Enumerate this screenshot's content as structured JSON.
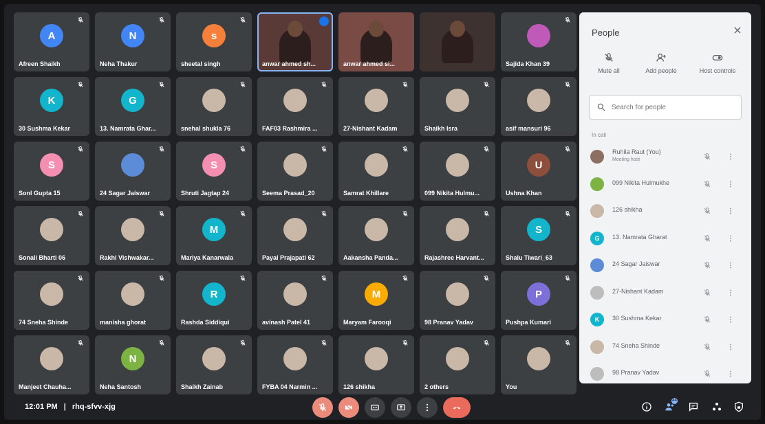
{
  "tiles": [
    {
      "name": "Afreen Shaikh",
      "initial": "A",
      "color": "#4285f4"
    },
    {
      "name": "Neha Thakur",
      "initial": "N",
      "color": "#4285f4"
    },
    {
      "name": "sheetal singh",
      "initial": "s",
      "color": "#f4803c"
    },
    {
      "name": "anwar ahmed sh...",
      "video": true
    },
    {
      "name": "anwar ahmed si...",
      "video": true
    },
    {
      "name": "",
      "video": true
    },
    {
      "name": "Sajida Khan 39",
      "initial": "",
      "color": "#c05ab8"
    },
    {
      "name": "30 Sushma Kekar",
      "initial": "K",
      "color": "#12b5cb"
    },
    {
      "name": "13. Namrata Ghar...",
      "initial": "G",
      "color": "#12b5cb"
    },
    {
      "name": "snehal shukla 76",
      "photo": true
    },
    {
      "name": "FAF03 Rashmira ...",
      "photo": true
    },
    {
      "name": "27-Nishant Kadam",
      "photo": true
    },
    {
      "name": "Shaikh Isra",
      "photo": true
    },
    {
      "name": "asif mansuri 96",
      "photo": true
    },
    {
      "name": "Sonl Gupta 15",
      "initial": "S",
      "color": "#f48fb1"
    },
    {
      "name": "24 Sagar Jaiswar",
      "initial": "",
      "color": "#5c8bd8"
    },
    {
      "name": "Shruti Jagtap 24",
      "initial": "S",
      "color": "#f48fb1"
    },
    {
      "name": "Seema Prasad_20",
      "photo": true
    },
    {
      "name": "Samrat Khillare",
      "photo": true
    },
    {
      "name": "099 Nikita Hulmu...",
      "photo": true
    },
    {
      "name": "Ushna Khan",
      "initial": "U",
      "color": "#8d4e3c"
    },
    {
      "name": "Sonali Bharti 06",
      "photo": true
    },
    {
      "name": "Rakhi Vishwakar...",
      "photo": true
    },
    {
      "name": "Mariya Kanarwala",
      "initial": "M",
      "color": "#12b5cb"
    },
    {
      "name": "Payal Prajapati 62",
      "photo": true
    },
    {
      "name": "Aakansha Panda...",
      "photo": true
    },
    {
      "name": "Rajashree Harvant...",
      "photo": true
    },
    {
      "name": "Shalu Tiwari_63",
      "initial": "S",
      "color": "#12b5cb"
    },
    {
      "name": "74 Sneha Shinde",
      "photo": true
    },
    {
      "name": "manisha ghorat",
      "photo": true
    },
    {
      "name": "Rashda Siddiqui",
      "initial": "R",
      "color": "#12b5cb"
    },
    {
      "name": "avinash Patel 41",
      "photo": true
    },
    {
      "name": "Maryam Farooqi",
      "initial": "M",
      "color": "#f9ab00"
    },
    {
      "name": "98 Pranav Yadav",
      "photo": true
    },
    {
      "name": "Pushpa Kumari",
      "initial": "P",
      "color": "#7c6fd8"
    },
    {
      "name": "Manjeet Chauha...",
      "photo": true
    },
    {
      "name": "Neha Santosh",
      "initial": "N",
      "color": "#7cb342"
    },
    {
      "name": "Shaikh Zainab",
      "photo": true
    },
    {
      "name": "FYBA 04 Narmin ...",
      "photo": true
    },
    {
      "name": "126 shikha",
      "photo": true
    },
    {
      "name": "2 others",
      "photo": true
    },
    {
      "name": "You",
      "photo": true
    }
  ],
  "bottom": {
    "time": "12:01 PM",
    "separator": "|",
    "code": "rhq-sfvv-xjg"
  },
  "panel": {
    "title": "People",
    "actions": [
      "Mute all",
      "Add people",
      "Host controls"
    ],
    "search_placeholder": "Search for people",
    "section": "In call",
    "participants": [
      {
        "name": "Ruhila Raut (You)",
        "role": "Meeting host",
        "color": "#8d6e63"
      },
      {
        "name": "099 Nikita Hulmukhe",
        "role": "",
        "color": "#7cb342"
      },
      {
        "name": "126 shikha",
        "role": "",
        "color": "#c9b7a8"
      },
      {
        "name": "13. Namrata Gharat",
        "role": "",
        "color": "#12b5cb",
        "initial": "G"
      },
      {
        "name": "24 Sagar Jaiswar",
        "role": "",
        "color": "#5c8bd8"
      },
      {
        "name": "27-Nishant Kadam",
        "role": "",
        "color": "#bdbdbd"
      },
      {
        "name": "30 Sushma Kekar",
        "role": "",
        "color": "#12b5cb",
        "initial": "K"
      },
      {
        "name": "74 Sneha Shinde",
        "role": "",
        "color": "#c9b7a8"
      },
      {
        "name": "98 Pranav Yadav",
        "role": "",
        "color": "#bdbdbd"
      }
    ]
  },
  "badge_count": "44"
}
